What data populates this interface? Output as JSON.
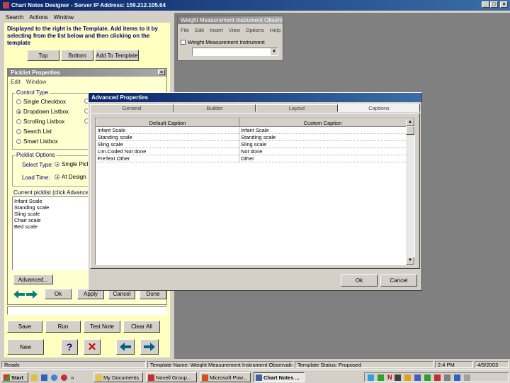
{
  "main_window": {
    "title": "Chart Notes Designer - Server IP Address: 159.212.105.64",
    "menu": [
      "Search",
      "Actions",
      "Window"
    ],
    "controls": {
      "minimize": "_",
      "maximize": "□",
      "close": "×"
    }
  },
  "left_panel": {
    "instructions": "Displayed to the right is the Template. Add items to it by selecting from the list below and then clicking on the template",
    "top_buttons": [
      "Top",
      "Bottom",
      "Add To Template"
    ],
    "properties": {
      "title": "Picklist Properties",
      "menu": [
        "Edit",
        "Window"
      ],
      "control_type_label": "Control Type",
      "control_types_left": [
        "Single Checkbox",
        "Dropdown Listbox",
        "Scrolling Listbox",
        "Search List",
        "Smart Listbox"
      ],
      "control_types_selected": 1,
      "picklist_options_label": "Picklist Options",
      "select_type_label": "Select Type:",
      "select_type_value": "Single Pick",
      "load_time_label": "Load Time:",
      "load_time_value": "At Design T",
      "current_picklist_label": "Current picklist (click Advanced",
      "current_picklist_items": [
        "Infant Scale",
        "Standing scale",
        "Sling scale",
        "Chair scale",
        "Bed scale"
      ],
      "advanced_button": "Advanced...",
      "action_buttons": [
        "Ok",
        "Apply",
        "Cancel",
        "Done"
      ]
    },
    "bottom_buttons_row1": [
      "Save",
      "Run",
      "Test Note",
      "Clear All"
    ],
    "new_button": "New"
  },
  "template_window": {
    "title": "Weight Measurement Instrument Observation",
    "menu": [
      "File",
      "Edit",
      "Insert",
      "View",
      "Options",
      "Help"
    ],
    "checkbox_label": "Weight Measurement Instrument"
  },
  "advanced_dialog": {
    "title": "Advanced Properties",
    "tabs": [
      "General",
      "Builder",
      "Layout",
      "Captions"
    ],
    "active_tab": 3,
    "columns": [
      "Default Caption",
      "Custom Caption"
    ],
    "rows": [
      [
        "Infant Scale",
        "Infant Scale"
      ],
      [
        "Standing scale",
        "Standing scale"
      ],
      [
        "Sling scale",
        "Sling scale"
      ],
      [
        "Lim.Coded Not done",
        "Not done"
      ],
      [
        "FreText Other",
        "Other"
      ]
    ],
    "ok_button": "Ok",
    "cancel_button": "Cancel"
  },
  "status_bar": {
    "ready": "Ready",
    "template_name": "Template Name: Weight Measurement Instrument Observation",
    "template_status": "Template Status: Proposed",
    "time": "2:4  PM",
    "date": "4/9/2003"
  },
  "taskbar": {
    "start": "Start",
    "tasks": [
      "My Documents",
      "Novell Group...",
      "Microsoft Pow...",
      "Chart Notes ..."
    ]
  }
}
